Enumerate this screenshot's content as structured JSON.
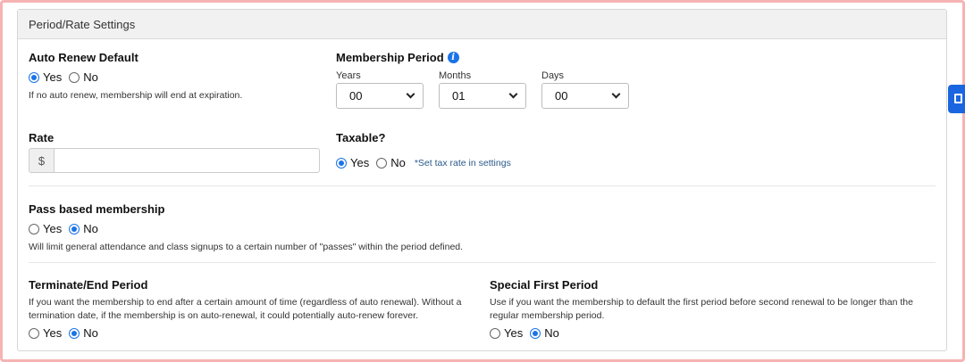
{
  "panel": {
    "title": "Period/Rate Settings"
  },
  "auto_renew": {
    "label": "Auto Renew Default",
    "yes": "Yes",
    "no": "No",
    "selected": "yes",
    "help": "If no auto renew, membership will end at expiration."
  },
  "membership_period": {
    "label": "Membership Period",
    "info_icon": "info-icon",
    "years": {
      "label": "Years",
      "value": "00"
    },
    "months": {
      "label": "Months",
      "value": "01"
    },
    "days": {
      "label": "Days",
      "value": "00"
    }
  },
  "rate": {
    "label": "Rate",
    "prefix": "$",
    "value": ""
  },
  "taxable": {
    "label": "Taxable?",
    "yes": "Yes",
    "no": "No",
    "selected": "yes",
    "link": "*Set tax rate in settings"
  },
  "pass_based": {
    "label": "Pass based membership",
    "yes": "Yes",
    "no": "No",
    "selected": "no",
    "help": "Will limit general attendance and class signups to a certain number of \"passes\" within the period defined."
  },
  "terminate": {
    "label": "Terminate/End Period",
    "help_line1": "If you want the membership to end after a certain amount of time (regardless of auto renewal). Without a",
    "help_line2": "termination date, if the membership is on auto-renewal, it could potentially auto-renew forever.",
    "yes": "Yes",
    "no": "No",
    "selected": "no"
  },
  "special_first": {
    "label": "Special First Period",
    "help_line1": "Use if you want the membership to default the first period before second renewal to be longer than the",
    "help_line2": "regular membership period.",
    "yes": "Yes",
    "no": "No",
    "selected": "no"
  },
  "colors": {
    "accent": "#1a73e8",
    "frame": "#f6b3b3",
    "side_tab": "#1a66e0"
  }
}
